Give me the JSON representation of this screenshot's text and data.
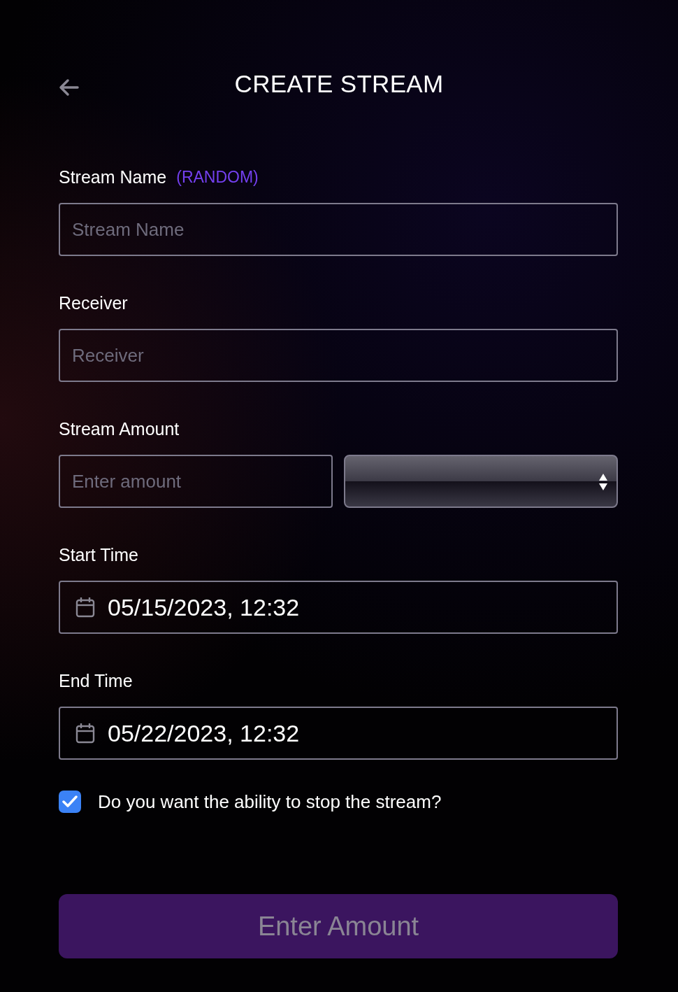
{
  "header": {
    "title": "CREATE STREAM"
  },
  "fields": [
    {
      "kind": "text",
      "label": "Stream Name",
      "hint": "(RANDOM)",
      "placeholder": "Stream Name"
    },
    {
      "kind": "text",
      "label": "Receiver",
      "placeholder": "Receiver"
    },
    {
      "kind": "amount",
      "label": "Stream Amount",
      "placeholder": "Enter amount"
    },
    {
      "kind": "datetime",
      "label": "Start Time",
      "value": "05/15/2023, 12:32"
    },
    {
      "kind": "datetime",
      "label": "End Time",
      "value": "05/22/2023, 12:32"
    }
  ],
  "stop_option": {
    "label": "Do you want the ability to stop the stream?",
    "checked": true
  },
  "submit_button": {
    "label": "Enter Amount",
    "disabled": true
  }
}
